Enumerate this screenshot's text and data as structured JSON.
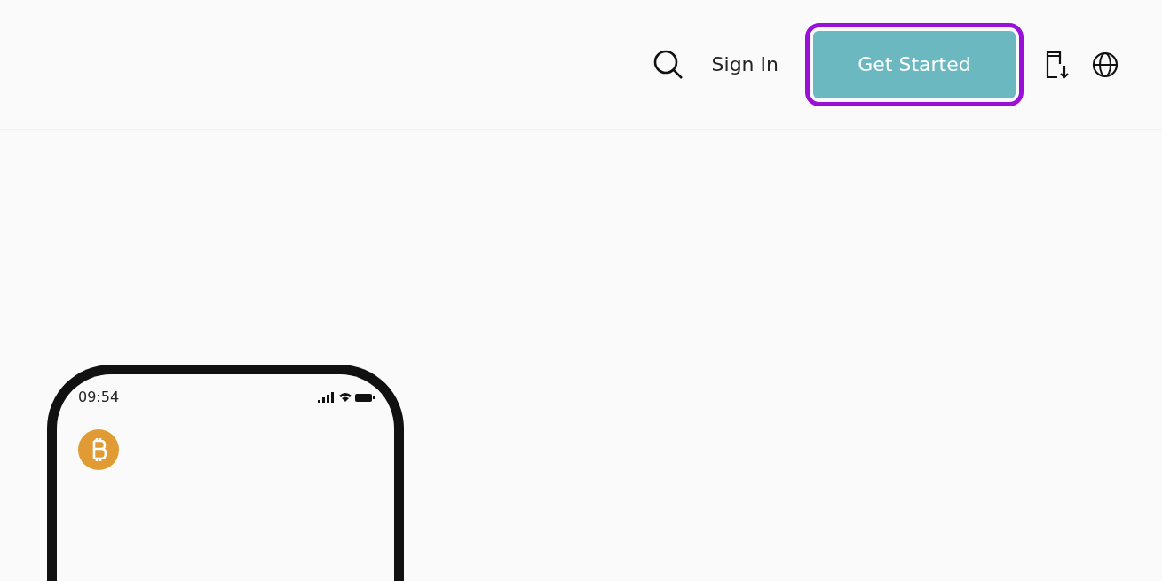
{
  "header": {
    "nav": [
      {
        "kind": "search"
      },
      {
        "kind": "link",
        "label": "Sign In"
      },
      {
        "kind": "cta",
        "label": "Get Started",
        "highlighted": true
      },
      {
        "kind": "download"
      },
      {
        "kind": "language"
      }
    ]
  },
  "phone": {
    "status_bar": {
      "time": "09:54"
    }
  }
}
